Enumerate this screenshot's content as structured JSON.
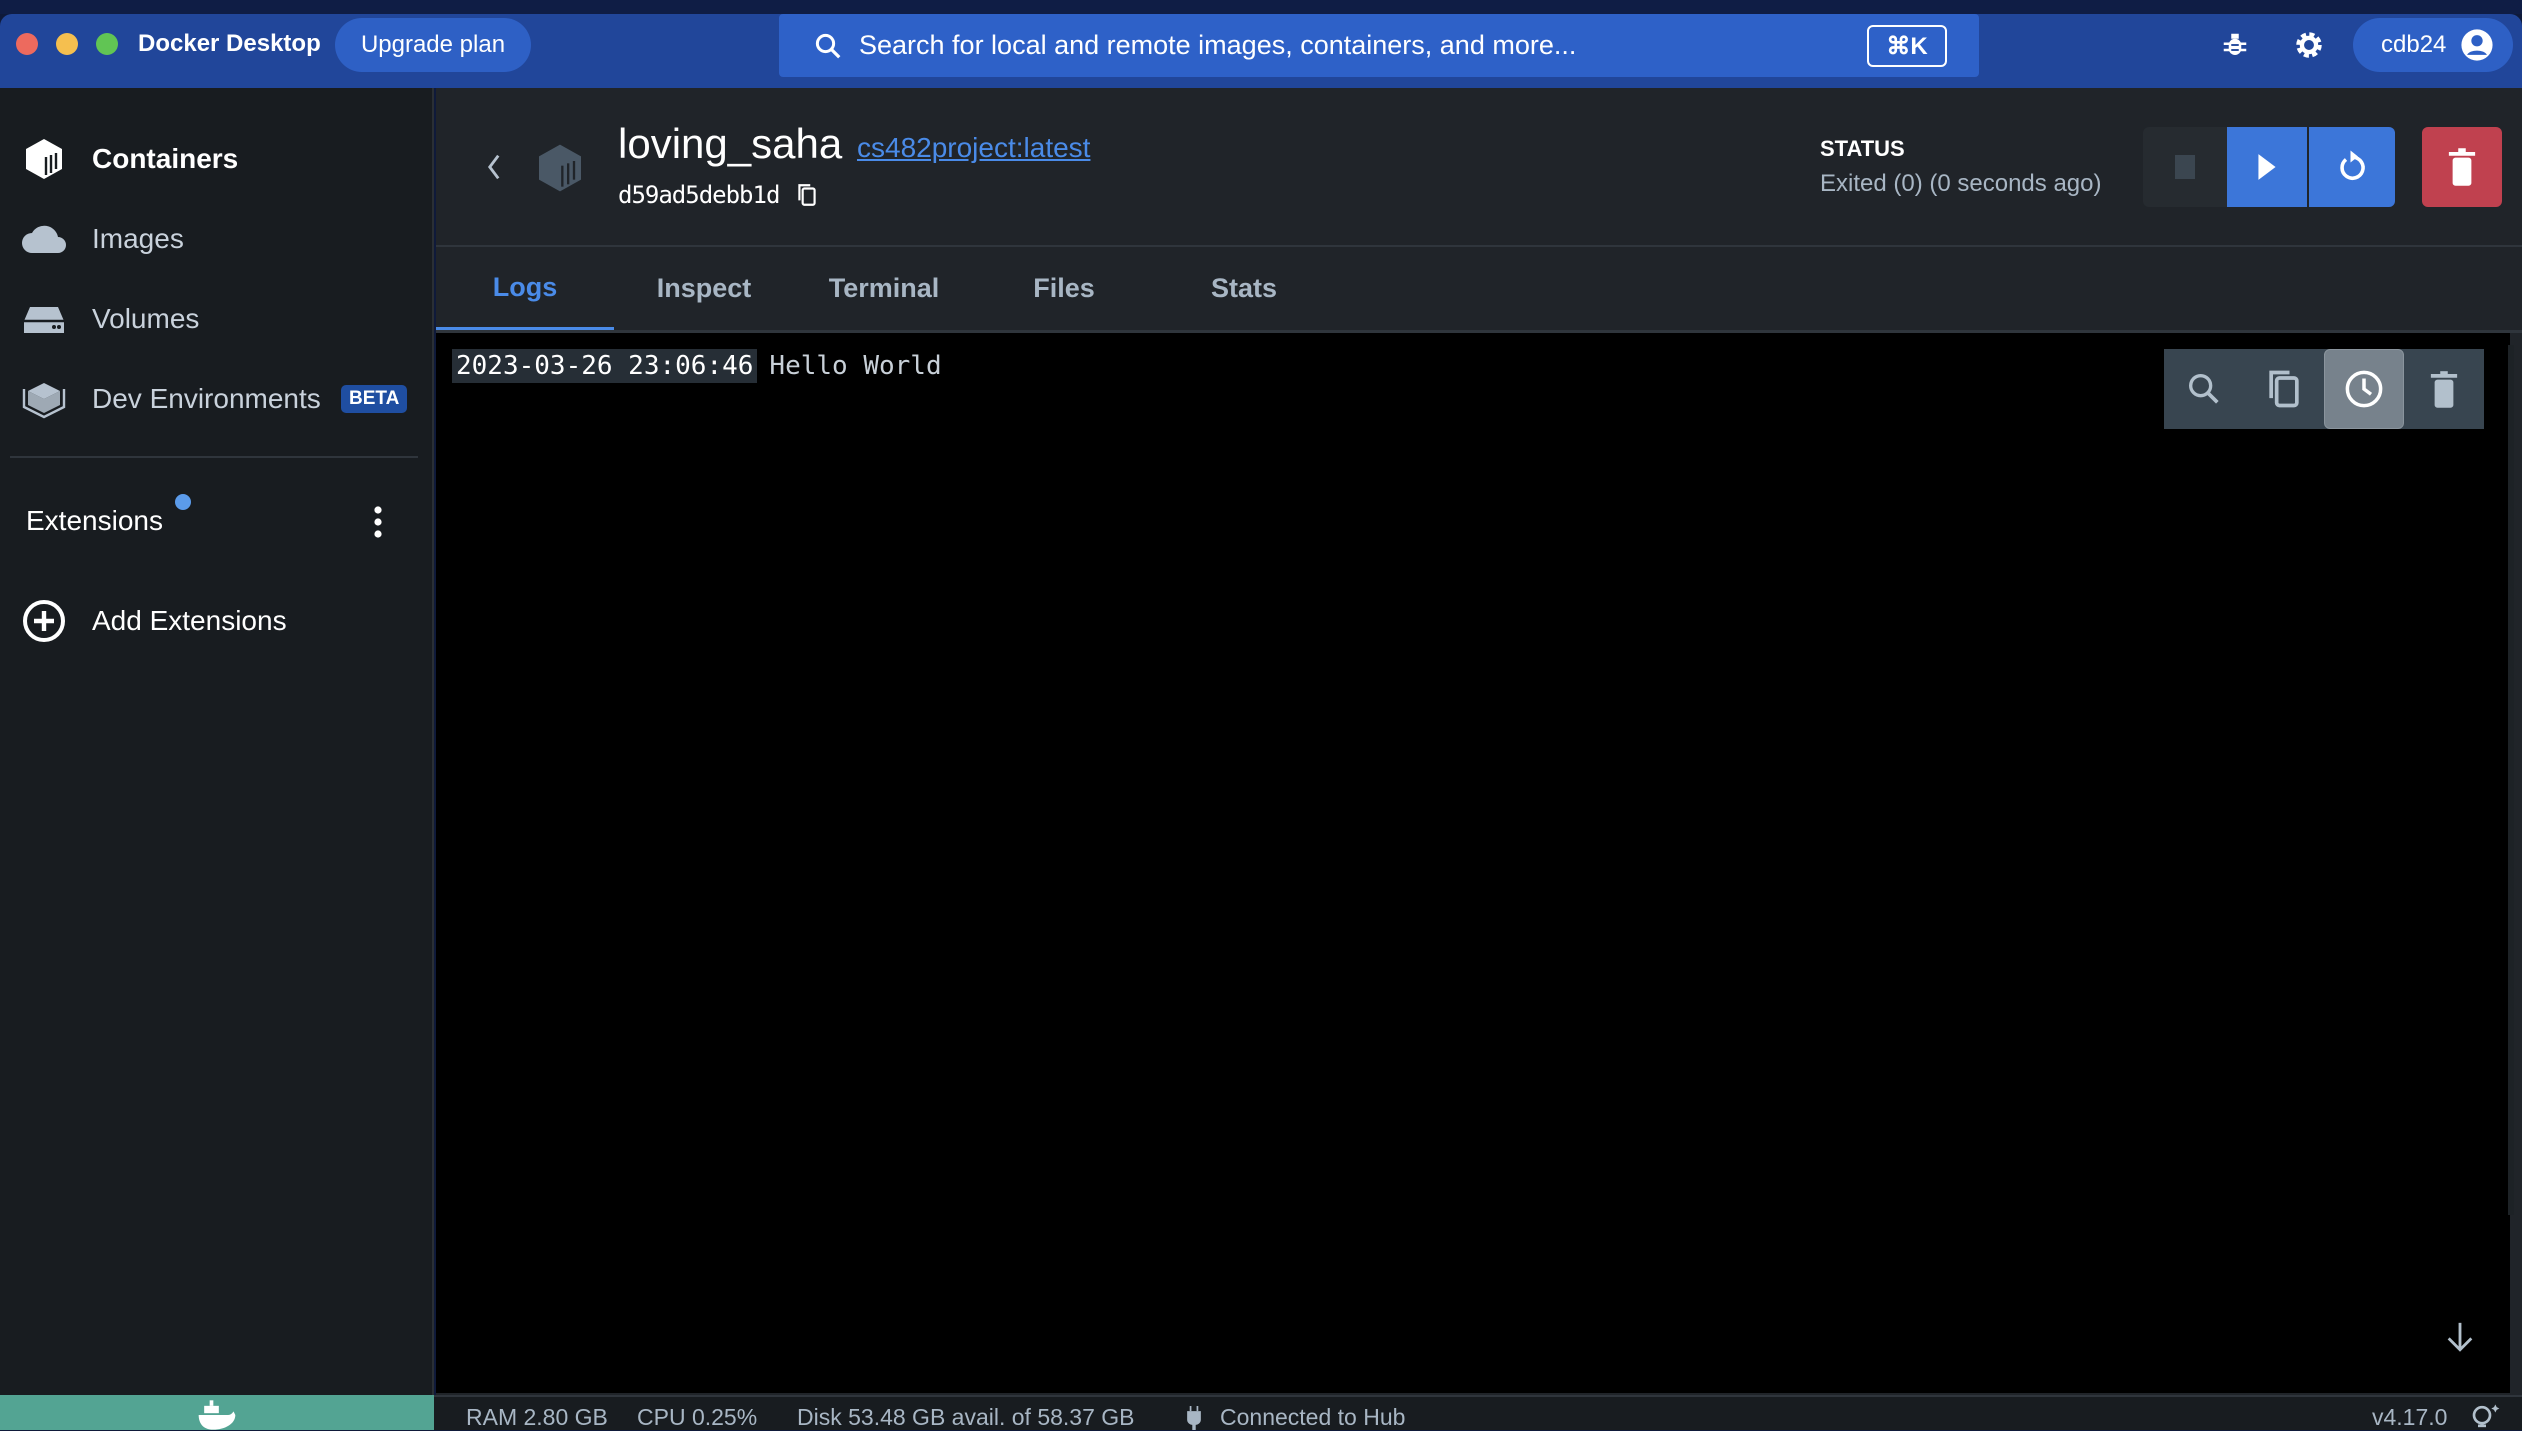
{
  "titlebar": {
    "app_name": "Docker Desktop",
    "upgrade_label": "Upgrade plan",
    "search_placeholder": "Search for local and remote images, containers, and more...",
    "search_shortcut": "⌘K",
    "username": "cdb24"
  },
  "sidebar": {
    "items": [
      {
        "label": "Containers",
        "icon": "container-icon",
        "active": true
      },
      {
        "label": "Images",
        "icon": "cloud-icon"
      },
      {
        "label": "Volumes",
        "icon": "volume-icon"
      },
      {
        "label": "Dev Environments",
        "icon": "dev-env-icon",
        "badge": "BETA"
      }
    ],
    "extensions_label": "Extensions",
    "add_extensions_label": "Add Extensions"
  },
  "container": {
    "name": "loving_saha",
    "image_link": "cs482project:latest",
    "id": "d59ad5debb1d",
    "status_label": "STATUS",
    "status_value": "Exited (0) (0 seconds ago)"
  },
  "tabs": [
    {
      "label": "Logs",
      "active": true
    },
    {
      "label": "Inspect"
    },
    {
      "label": "Terminal"
    },
    {
      "label": "Files"
    },
    {
      "label": "Stats"
    }
  ],
  "logs": [
    {
      "timestamp": "2023-03-26 23:06:46",
      "message": "Hello World"
    }
  ],
  "statusbar": {
    "ram": "RAM 2.80 GB",
    "cpu": "CPU 0.25%",
    "disk": "Disk 53.48 GB avail. of 58.37 GB",
    "hub": "Connected to Hub",
    "version": "v4.17.0"
  },
  "colors": {
    "accent": "#4a8be8",
    "titlebar": "#21469a",
    "delete": "#c0414f",
    "engine_running": "#53a493"
  }
}
